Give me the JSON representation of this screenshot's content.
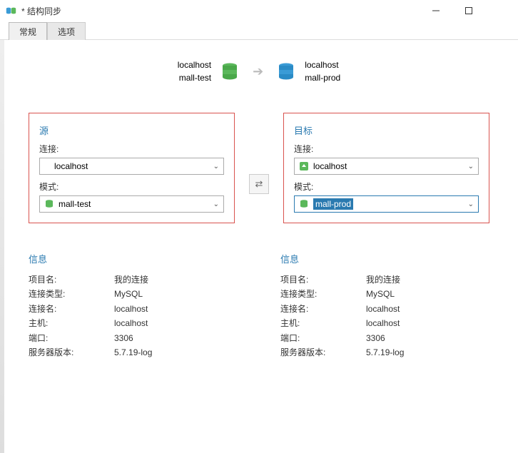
{
  "window": {
    "title": "* 结构同步"
  },
  "tabs": {
    "general": "常规",
    "options": "选项"
  },
  "summary": {
    "source_conn": "localhost",
    "source_db": "mall-test",
    "target_conn": "localhost",
    "target_db": "mall-prod"
  },
  "source_panel": {
    "title": "源",
    "conn_label": "连接:",
    "conn_value": "localhost",
    "schema_label": "模式:",
    "schema_value": "mall-test"
  },
  "target_panel": {
    "title": "目标",
    "conn_label": "连接:",
    "conn_value": "localhost",
    "schema_label": "模式:",
    "schema_value": "mall-prod"
  },
  "info_labels": {
    "title": "信息",
    "project": "项目名:",
    "conn_type": "连接类型:",
    "conn_name": "连接名:",
    "host": "主机:",
    "port": "端口:",
    "server_ver": "服务器版本:"
  },
  "source_info": {
    "project": "我的连接",
    "conn_type": "MySQL",
    "conn_name": "localhost",
    "host": "localhost",
    "port": "3306",
    "server_ver": "5.7.19-log"
  },
  "target_info": {
    "project": "我的连接",
    "conn_type": "MySQL",
    "conn_name": "localhost",
    "host": "localhost",
    "port": "3306",
    "server_ver": "5.7.19-log"
  }
}
